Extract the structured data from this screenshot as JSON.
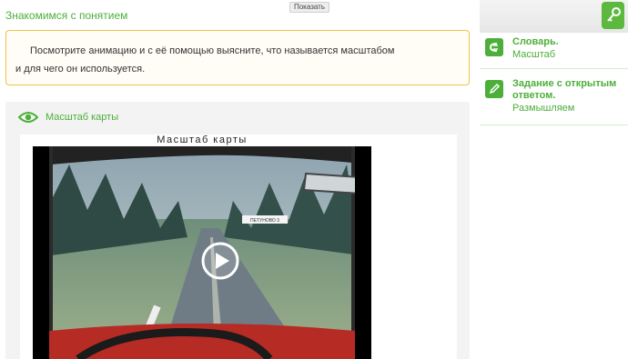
{
  "show_button": "Показать",
  "section_title": "Знакомимся с понятием",
  "task": {
    "line1": "Посмотрите анимацию и с её помощью выясните, что называется масштабом",
    "line2": "и для чего он используется."
  },
  "media": {
    "icon": "eye-icon",
    "title": "Масштаб карты",
    "video_title": "Масштаб карты",
    "road_sign": "ПЕТУНОВО 3",
    "play_icon": "play-icon"
  },
  "sidebar": {
    "key_icon": "key-icon",
    "items": [
      {
        "icon": "dictionary-icon",
        "label": "Словарь.",
        "sub": "Масштаб"
      },
      {
        "icon": "pencil-icon",
        "label": "Задание с открытым ответом.",
        "sub": "Размышляем"
      }
    ]
  },
  "colors": {
    "accent": "#4caf3a",
    "task_border": "#f0c24a",
    "card_bg": "#f3f3f3"
  }
}
